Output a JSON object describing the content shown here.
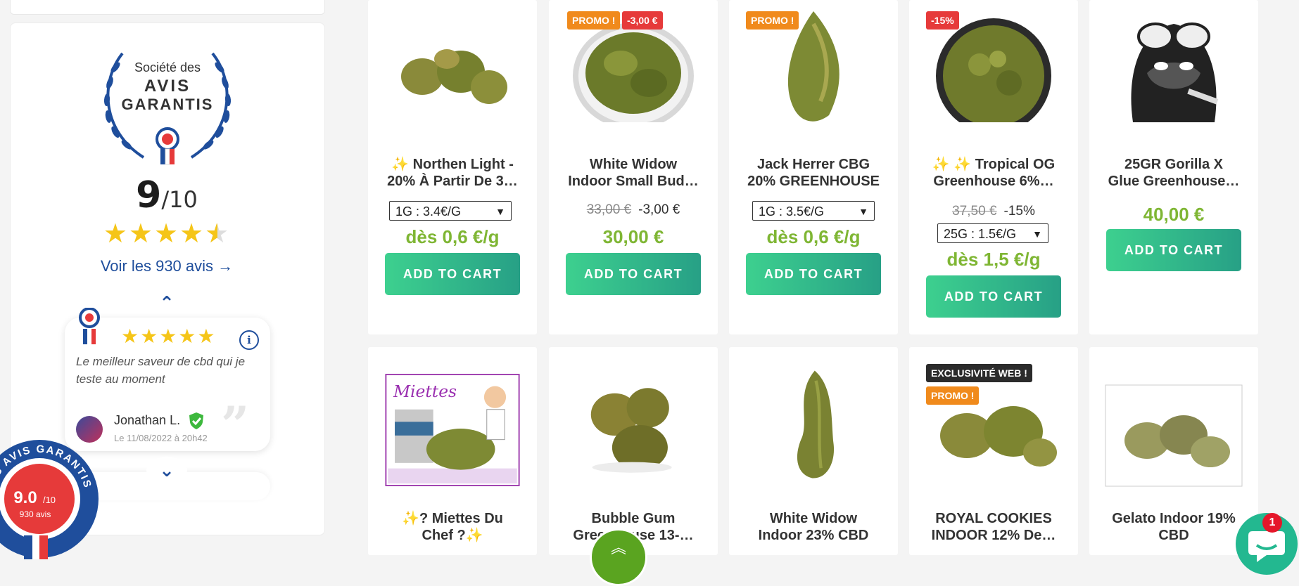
{
  "sidebar": {
    "seal": {
      "line1": "Société des",
      "line2": "AVIS",
      "line3": "GARANTIS"
    },
    "score_main": "9",
    "score_total": "/10",
    "rating_stars": 4.5,
    "see_reviews": "Voir les 930 avis",
    "review": {
      "stars": 5,
      "text": "Le meilleur saveur de cbd qui je teste au moment",
      "author": "Jonathan L.",
      "date": "Le 11/08/2022 à 20h42"
    },
    "badge": {
      "arc": "DES AVIS GARANTIS",
      "score": "9.0",
      "scale": "/10",
      "count": "930 avis"
    }
  },
  "products_row1": [
    {
      "name": "✨ Northen Light - 20% À Partir De 3…",
      "line1": "✨ Northen Light -",
      "line2": "20% À Partir De 3…",
      "select": "1G : 3.4€/G",
      "price": "dès 0,6 €/g",
      "button": "ADD TO CART",
      "tags": []
    },
    {
      "name": "White Widow Indoor Small Bud…",
      "line1": "White Widow",
      "line2": "Indoor Small Bud…",
      "old_price": "33,00 €",
      "discount": "-3,00 €",
      "price": "30,00 €",
      "button": "ADD TO CART",
      "tags": [
        "PROMO !",
        "-3,00 €"
      ]
    },
    {
      "name": "Jack Herrer CBG 20% GREENHOUSE",
      "line1": "Jack Herrer CBG",
      "line2": "20% GREENHOUSE",
      "select": "1G : 3.5€/G",
      "price": "dès 0,6 €/g",
      "button": "ADD TO CART",
      "tags": [
        "PROMO !"
      ]
    },
    {
      "name": "✨ ✨ Tropical OG Greenhouse 6%…",
      "line1": "✨ ✨ Tropical OG",
      "line2": "Greenhouse 6%…",
      "old_price": "37,50 €",
      "discount": "-15%",
      "select": "25G : 1.5€/G",
      "price": "dès 1,5 €/g",
      "button": "ADD TO CART",
      "tags": [
        "-15%"
      ]
    },
    {
      "name": "25GR Gorilla X Glue Greenhouse…",
      "line1": "25GR Gorilla X",
      "line2": "Glue Greenhouse…",
      "price": "40,00 €",
      "button": "ADD TO CART",
      "tags": []
    }
  ],
  "products_row2": [
    {
      "line1": "✨? Miettes Du",
      "line2": "Chef ?✨",
      "img_text": "Miettes",
      "tags": []
    },
    {
      "line1": "Bubble Gum",
      "line2": "Greenhouse 13-…",
      "tags": []
    },
    {
      "line1": "White Widow",
      "line2": "Indoor 23% CBD",
      "tags": []
    },
    {
      "line1": "ROYAL COOKIES",
      "line2": "INDOOR 12% De…",
      "tags": [
        "EXCLUSIVITÉ WEB !",
        "PROMO !"
      ]
    },
    {
      "line1": "Gelato Indoor 19%",
      "line2": "CBD",
      "tags": []
    }
  ],
  "chat": {
    "count": "1"
  },
  "colors": {
    "accent_green": "#7fb634",
    "button_from": "#3dd08f",
    "button_to": "#27a086",
    "promo_orange": "#f08a1c",
    "promo_red": "#e63a3a",
    "brand_blue": "#1f4e9c"
  }
}
